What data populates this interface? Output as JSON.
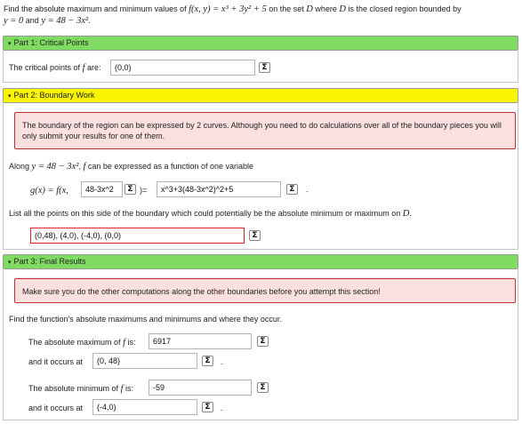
{
  "problem": {
    "text_a": "Find the absolute maximum and minimum values of",
    "func_def": "f(x, y) = x³ + 3y² + 5",
    "text_b": "on the set",
    "set_name": "D",
    "text_c": "where",
    "text_d": "is the closed region bounded by",
    "line1": "y = 0",
    "text_and": "and",
    "line2": "y = 48 − 3x²",
    "period": "."
  },
  "part1": {
    "header": "Part 1: Critical Points",
    "prompt_a": "The critical points of",
    "f": "f",
    "prompt_b": "are:",
    "critical_value": "(0,0)"
  },
  "part2": {
    "header": "Part 2: Boundary Work",
    "alert": "The boundary of the region can be expressed by 2 curves. Although you need to do calculations over all of the boundary pieces you will only submit your results for one of them.",
    "along_a": "Along",
    "along_curve": "y = 48 − 3x²",
    "along_comma": ",",
    "along_b": "can be expressed as a function of one variable",
    "g_lhs": "g(x) = f(x,",
    "g_sub_value": "48-3x^2",
    "g_mid": ")=",
    "g_expr_value": "x^3+3(48-3x^2)^2+5",
    "list_prompt": "List all the points on this side of the boundary which could potentially be the absolute minimum or maximum on",
    "list_D": "D",
    "points_value": "(0,48), (4,0), (-4,0), (0,0)"
  },
  "part3": {
    "header": "Part 3: Final Results",
    "alert": "Make sure you do the other computations along the other boundaries before you attempt this section!",
    "find_prompt": "Find the function's absolute maximums and minimums and where they occur.",
    "max_prompt_a": "The absolute maximum of",
    "max_prompt_b": "is:",
    "max_value": "6917",
    "max_at_prompt": "and it occurs at",
    "max_at_value": "(0, 48)",
    "min_prompt_a": "The absolute minimum of",
    "min_prompt_b": "is:",
    "min_value": "-59",
    "min_at_prompt": "and it occurs at",
    "min_at_value": "(-4,0)"
  },
  "icons": {
    "triangle": "▾",
    "sigma": "Σ"
  },
  "colors": {
    "green_header": "#80db63",
    "yellow_header": "#f9f400",
    "alert_bg": "#fbe0e0",
    "alert_border": "#bb3333"
  }
}
